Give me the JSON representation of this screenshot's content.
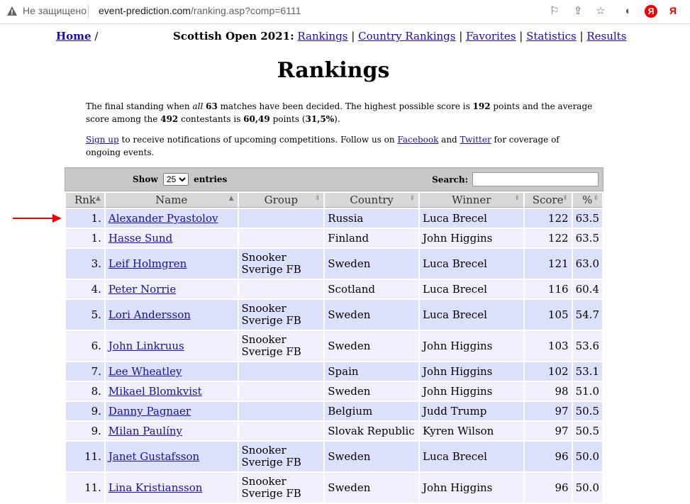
{
  "browser": {
    "security_label": "Не защищено",
    "url_host": "event-prediction.com",
    "url_path": "/ranking.asp?comp=6111",
    "ya_badge": "Я",
    "ya_label": "Я"
  },
  "nav": {
    "home": "Home",
    "home_sep": "/",
    "competition": "Scottish Open 2021:",
    "links": [
      "Rankings",
      "Country Rankings",
      "Favorites",
      "Statistics",
      "Results"
    ]
  },
  "page_title": "Rankings",
  "intro": {
    "p1_a": "The final standing when ",
    "p1_all": "all",
    "p1_b": " ",
    "p1_matches": "63",
    "p1_c": " matches have been decided. The highest possible score is ",
    "p1_max": "192",
    "p1_d": " points and the average score among the ",
    "p1_count": "492",
    "p1_e": " contestants is ",
    "p1_avg": "60,49",
    "p1_f": " points (",
    "p1_pct": "31,5%",
    "p1_g": ").",
    "p2_signup": "Sign up",
    "p2_a": " to receive notifications of upcoming competitions. Follow us on ",
    "p2_facebook": "Facebook",
    "p2_b": " and ",
    "p2_twitter": "Twitter",
    "p2_c": " for coverage of ongoing events."
  },
  "controls": {
    "show_label": "Show",
    "entries_value": "25",
    "entries_label": "entries",
    "search_label": "Search:"
  },
  "table": {
    "headers": [
      "Rnk",
      "Name",
      "Group",
      "Country",
      "Winner",
      "Score",
      "%"
    ],
    "rows": [
      {
        "rnk": "1.",
        "name": "Alexander Pyastolov",
        "group": "",
        "country": "Russia",
        "winner": "Luca Brecel",
        "score": "122",
        "pct": "63.5"
      },
      {
        "rnk": "1.",
        "name": "Hasse Sund",
        "group": "",
        "country": "Finland",
        "winner": "John Higgins",
        "score": "122",
        "pct": "63.5"
      },
      {
        "rnk": "3.",
        "name": "Leif Holmgren",
        "group": "Snooker Sverige FB",
        "country": "Sweden",
        "winner": "Luca Brecel",
        "score": "121",
        "pct": "63.0"
      },
      {
        "rnk": "4.",
        "name": "Peter Norrie",
        "group": "",
        "country": "Scotland",
        "winner": "Luca Brecel",
        "score": "116",
        "pct": "60.4"
      },
      {
        "rnk": "5.",
        "name": "Lori Andersson",
        "group": "Snooker Sverige FB",
        "country": "Sweden",
        "winner": "Luca Brecel",
        "score": "105",
        "pct": "54.7"
      },
      {
        "rnk": "6.",
        "name": "John Linkruus",
        "group": "Snooker Sverige FB",
        "country": "Sweden",
        "winner": "John Higgins",
        "score": "103",
        "pct": "53.6"
      },
      {
        "rnk": "7.",
        "name": "Lee Wheatley",
        "group": "",
        "country": "Spain",
        "winner": "John Higgins",
        "score": "102",
        "pct": "53.1"
      },
      {
        "rnk": "8.",
        "name": "Mikael Blomkvist",
        "group": "",
        "country": "Sweden",
        "winner": "John Higgins",
        "score": "98",
        "pct": "51.0"
      },
      {
        "rnk": "9.",
        "name": "Danny Pagnaer",
        "group": "",
        "country": "Belgium",
        "winner": "Judd Trump",
        "score": "97",
        "pct": "50.5"
      },
      {
        "rnk": "9.",
        "name": "Milan Paulíny",
        "group": "",
        "country": "Slovak Republic",
        "winner": "Kyren Wilson",
        "score": "97",
        "pct": "50.5"
      },
      {
        "rnk": "11.",
        "name": "Janet Gustafsson",
        "group": "Snooker Sverige FB",
        "country": "Sweden",
        "winner": "Luca Brecel",
        "score": "96",
        "pct": "50.0"
      },
      {
        "rnk": "11.",
        "name": "Lina Kristiansson",
        "group": "Snooker Sverige FB",
        "country": "Sweden",
        "winner": "John Higgins",
        "score": "96",
        "pct": "50.0"
      }
    ]
  }
}
